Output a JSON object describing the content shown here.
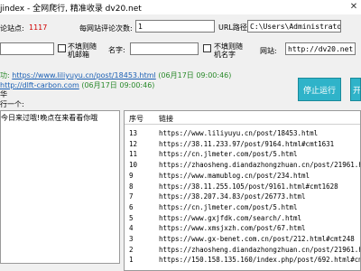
{
  "window": {
    "title": "jindex - 全网爬行, 精准收录  dv20.net",
    "close_glyph": "✕"
  },
  "stats": {
    "sites_label": "论站点:",
    "sites_value": "1117",
    "per_site_label": "每网站评论次数:",
    "per_site_value": "1",
    "url_path_label": "URL路径:",
    "url_path_value": "C:\\Users\\Administrator.W"
  },
  "options": {
    "random_email_label": "不填则随\n机邮箱",
    "name_label": "名字:",
    "name_value": "",
    "random_name_label": "不填则随\n机名字",
    "website_label": "网站:",
    "website_value": "http://dv20.net"
  },
  "log": {
    "line1_prefix": "功:",
    "line1_url": "https://www.liliyuyu.cn/post/18453.html",
    "line1_time": "(06月17日 09:00:46)",
    "line2_url": "http://dlft-carbon.com",
    "line2_time": "(06月17日 09:00:46)",
    "line3": "华",
    "line4": "行一个:"
  },
  "comment": {
    "text": "今日来过哦!晚点在来看看你哦"
  },
  "buttons": {
    "stop_label": "停止运行",
    "start_label": "开"
  },
  "table": {
    "headers": [
      "序号",
      "链接"
    ],
    "rows": [
      {
        "id": "13",
        "link": "https://www.liliyuyu.cn/post/18453.html"
      },
      {
        "id": "12",
        "link": "https://38.11.233.97/post/9164.html#cmt1631"
      },
      {
        "id": "11",
        "link": "https://cn.jlmeter.com/post/5.html"
      },
      {
        "id": "10",
        "link": "https://zhaosheng.diandazhongzhuan.cn/post/21961.html"
      },
      {
        "id": "9",
        "link": "https://www.mamublog.cn/post/234.html"
      },
      {
        "id": "8",
        "link": "https://38.11.255.105/post/9161.html#cmt1628"
      },
      {
        "id": "7",
        "link": "https://38.207.34.83/post/26773.html"
      },
      {
        "id": "6",
        "link": "https://cn.jlmeter.com/post/5.html"
      },
      {
        "id": "5",
        "link": "https://www.gxjfdk.com/search/.html"
      },
      {
        "id": "4",
        "link": "https://www.xmsjxzh.com/post/67.html"
      },
      {
        "id": "3",
        "link": "https://www.gx-benet.com.cn/post/212.html#cmt248"
      },
      {
        "id": "2",
        "link": "https://zhaosheng.diandazhongzhuan.cn/post/21961.html"
      },
      {
        "id": "1",
        "link": "https://150.158.135.160/index.php/post/692.html#cmt11"
      }
    ]
  },
  "colors": {
    "accent": "#2fb3c9",
    "site_count": "#d00000",
    "link": "#1a5fb4",
    "green_text": "#2b8a2b"
  }
}
